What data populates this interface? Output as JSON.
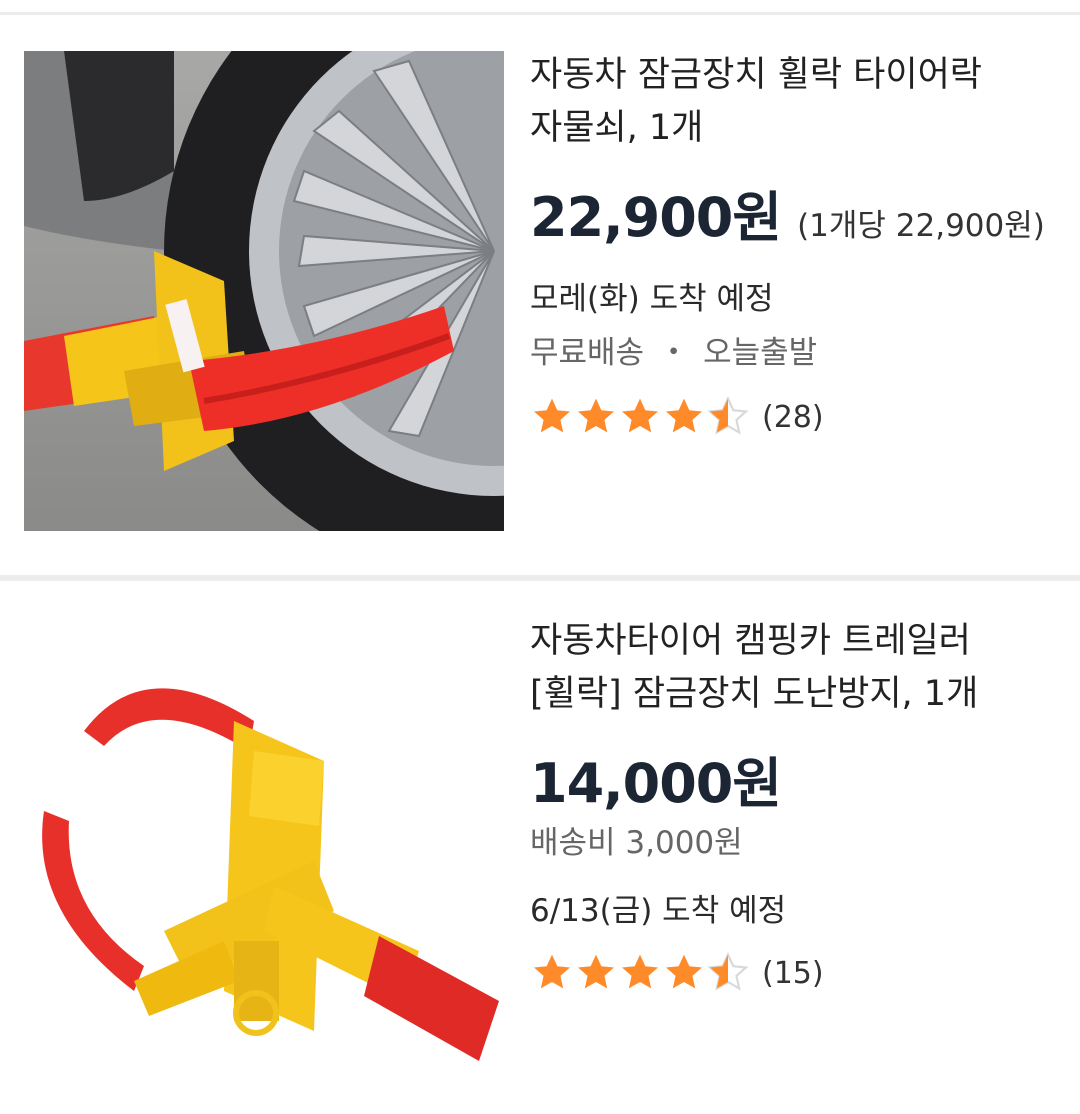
{
  "colors": {
    "star": "#ff8a2a",
    "price": "#1c2533",
    "divider": "#ececec",
    "muted": "#666666"
  },
  "products": [
    {
      "image_icon": "wheel-lock-on-tire-photo",
      "title_line1": "자동차 잠금장치 휠락 타이어락",
      "title_line2": "자물쇠, 1개",
      "price": "22,900원",
      "unit_price": "(1개당 22,900원)",
      "arrival": "모레(화) 도착 예정",
      "shipping": "무료배송",
      "separator": "・",
      "dispatch": "오늘출발",
      "rating": 4.5,
      "review_count": "(28)"
    },
    {
      "image_icon": "wheel-clamp-product-photo",
      "title_line1": "자동차타이어 캠핑카 트레일러",
      "title_line2": "[휠락] 잠금장치 도난방지, 1개",
      "price": "14,000원",
      "shipping_fee": "배송비 3,000원",
      "arrival": "6/13(금) 도착 예정",
      "rating": 4.5,
      "review_count": "(15)"
    }
  ]
}
